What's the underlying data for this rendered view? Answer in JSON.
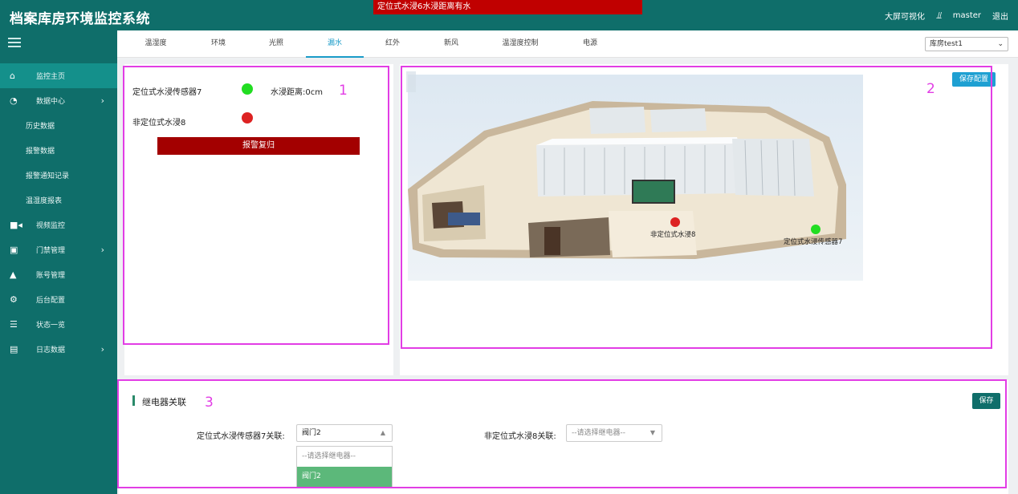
{
  "header": {
    "title": "档案库房环境监控系统",
    "alert": "定位式水浸6水浸距离有水",
    "big_screen": "大屏可视化",
    "user": "master",
    "logout": "退出"
  },
  "sidebar": {
    "items": [
      {
        "label": "监控主页",
        "icon": "home-icon"
      },
      {
        "label": "数据中心",
        "icon": "pie-chart-icon"
      },
      {
        "label": "历史数据"
      },
      {
        "label": "报警数据"
      },
      {
        "label": "报警通知记录"
      },
      {
        "label": "温湿度报表"
      },
      {
        "label": "视频监控",
        "icon": "video-camera-icon"
      },
      {
        "label": "门禁管理",
        "icon": "id-card-icon"
      },
      {
        "label": "账号管理",
        "icon": "user-icon"
      },
      {
        "label": "后台配置",
        "icon": "gears-icon"
      },
      {
        "label": "状态一览",
        "icon": "server-icon"
      },
      {
        "label": "日志数据",
        "icon": "list-icon"
      }
    ]
  },
  "tabs": [
    "温湿度",
    "环境",
    "光照",
    "漏水",
    "红外",
    "新风",
    "温湿度控制",
    "电源"
  ],
  "active_tab": "漏水",
  "room_select": "库房test1",
  "sensors": {
    "s7_name": "定位式水浸传感器7",
    "s7_distance": "水浸距离:0cm",
    "s7_status": "green",
    "s8_name": "非定位式水浸8",
    "s8_status": "red",
    "reset_label": "报警复归"
  },
  "plan": {
    "save_config": "保存配置",
    "marker_s8": "非定位式水浸8",
    "marker_s7": "定位式水浸传感器7"
  },
  "relay": {
    "title": "继电器关联",
    "save": "保存",
    "s7_label": "定位式水浸传感器7关联:",
    "s7_value": "阀门2",
    "s8_label": "非定位式水浸8关联:",
    "s8_placeholder": "--请选择继电器--",
    "options": [
      "--请选择继电器--",
      "阀门2"
    ]
  },
  "annotations": [
    "1",
    "2",
    "3"
  ],
  "colors": {
    "brand": "#0f6e6a",
    "alert": "#c00000",
    "accent": "#1ea0d2",
    "ok": "#22dd22",
    "alarm": "#dd2222",
    "annotation": "#e23de5"
  }
}
